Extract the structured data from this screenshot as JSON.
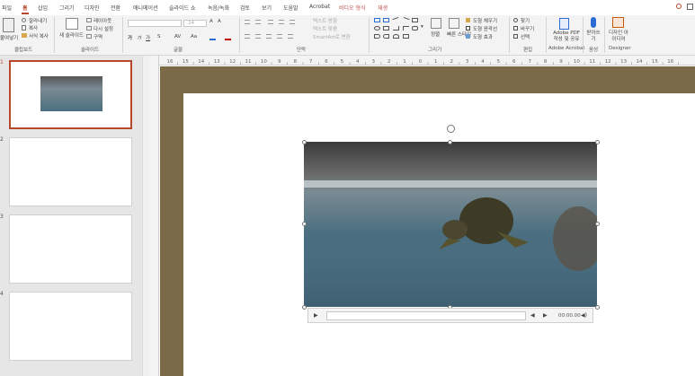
{
  "tabs": [
    "파일",
    "홈",
    "삽입",
    "그리기",
    "디자인",
    "전환",
    "애니메이션",
    "슬라이드 쇼",
    "녹음/녹화",
    "검토",
    "보기",
    "도움말",
    "Acrobat",
    "비디오 형식",
    "재생"
  ],
  "active_tab": "홈",
  "colors": {
    "accent": "#b7472a",
    "canvas": "#7b6a48",
    "contextual": "#c0504d"
  },
  "ribbon": {
    "clipboard": {
      "paste": "붙여넣기",
      "cut": "잘라내기",
      "copy": "복사",
      "format_painter": "서식 복사",
      "label": "클립보드"
    },
    "slides": {
      "new_slide": "새 슬라이드",
      "layout": "레이아웃",
      "reset": "다시 설정",
      "section": "구역",
      "label": "슬라이드"
    },
    "font": {
      "size": "24",
      "label": "글꼴"
    },
    "paragraph": {
      "text_direction": "텍스트 방향",
      "align_text": "텍스트 맞춤",
      "smartart": "SmartArt로 변환",
      "label": "단락"
    },
    "drawing": {
      "arrange": "정렬",
      "quick_styles": "빠른 스타일",
      "shape_fill": "도형 채우기",
      "shape_outline": "도형 윤곽선",
      "shape_effects": "도형 효과",
      "label": "그리기"
    },
    "editing": {
      "find": "찾기",
      "replace": "바꾸기",
      "select": "선택",
      "label": "편집"
    },
    "acrobat": {
      "create_pdf": "Adobe PDF 작성 및 공유",
      "label": "Adobe Acrobat"
    },
    "voice": {
      "dictate": "받아쓰기",
      "label": "음성"
    },
    "designer": {
      "design_ideas": "디자인 아이디어",
      "label": "Designer"
    }
  },
  "slides": [
    "1",
    "2",
    "3",
    "4"
  ],
  "ruler_ticks": [
    "16",
    "15",
    "14",
    "13",
    "12",
    "11",
    "10",
    "9",
    "8",
    "7",
    "6",
    "5",
    "4",
    "3",
    "2",
    "1",
    "0",
    "1",
    "2",
    "3",
    "4",
    "5",
    "6",
    "7",
    "8",
    "9",
    "10",
    "11",
    "12",
    "13",
    "14",
    "15",
    "16"
  ],
  "video": {
    "time": "00:00.00"
  }
}
